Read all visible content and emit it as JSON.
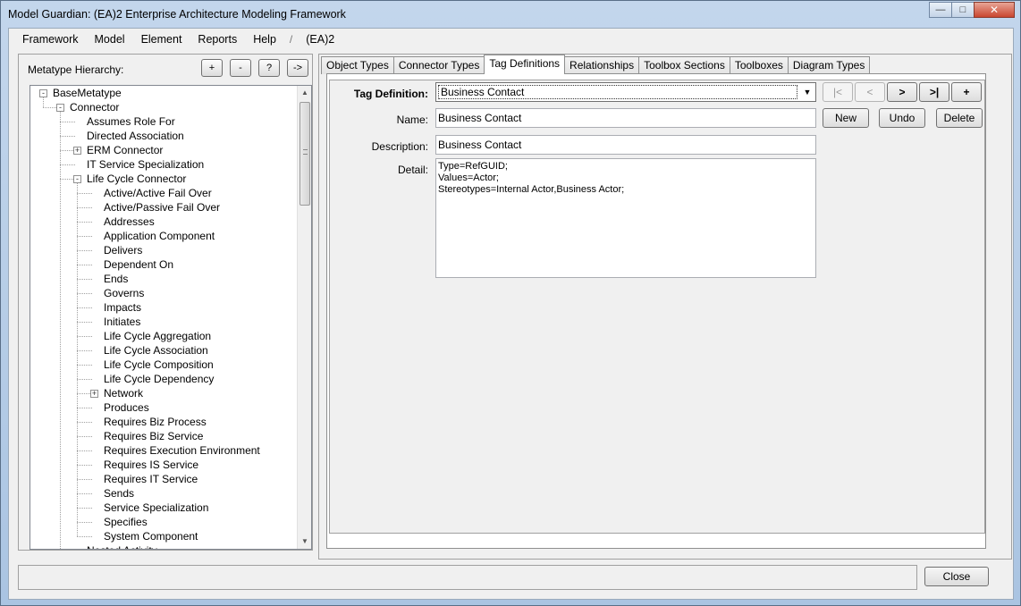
{
  "window": {
    "title": "Model Guardian: (EA)2 Enterprise Architecture Modeling Framework",
    "minimize_glyph": "—",
    "maximize_glyph": "□",
    "close_glyph": "✕"
  },
  "menu": {
    "items": [
      "Framework",
      "Model",
      "Element",
      "Reports",
      "Help"
    ],
    "separator": "/",
    "context": "(EA)2"
  },
  "left_panel": {
    "label": "Metatype Hierarchy:",
    "buttons": [
      "+",
      "-",
      "?",
      "->"
    ],
    "tree": [
      {
        "label": "BaseMetatype",
        "level": 0,
        "expander": "-"
      },
      {
        "label": "Connector",
        "level": 1,
        "expander": "-"
      },
      {
        "label": "Assumes Role For",
        "level": 2,
        "expander": null
      },
      {
        "label": "Directed Association",
        "level": 2,
        "expander": null
      },
      {
        "label": "ERM Connector",
        "level": 2,
        "expander": "+"
      },
      {
        "label": "IT Service Specialization",
        "level": 2,
        "expander": null
      },
      {
        "label": "Life Cycle Connector",
        "level": 2,
        "expander": "-"
      },
      {
        "label": "Active/Active Fail Over",
        "level": 3,
        "expander": null
      },
      {
        "label": "Active/Passive Fail Over",
        "level": 3,
        "expander": null
      },
      {
        "label": "Addresses",
        "level": 3,
        "expander": null
      },
      {
        "label": "Application Component",
        "level": 3,
        "expander": null
      },
      {
        "label": "Delivers",
        "level": 3,
        "expander": null
      },
      {
        "label": "Dependent On",
        "level": 3,
        "expander": null
      },
      {
        "label": "Ends",
        "level": 3,
        "expander": null
      },
      {
        "label": "Governs",
        "level": 3,
        "expander": null
      },
      {
        "label": "Impacts",
        "level": 3,
        "expander": null
      },
      {
        "label": "Initiates",
        "level": 3,
        "expander": null
      },
      {
        "label": "Life Cycle Aggregation",
        "level": 3,
        "expander": null
      },
      {
        "label": "Life Cycle Association",
        "level": 3,
        "expander": null
      },
      {
        "label": "Life Cycle Composition",
        "level": 3,
        "expander": null
      },
      {
        "label": "Life Cycle Dependency",
        "level": 3,
        "expander": null
      },
      {
        "label": "Network",
        "level": 3,
        "expander": "+"
      },
      {
        "label": "Produces",
        "level": 3,
        "expander": null
      },
      {
        "label": "Requires Biz Process",
        "level": 3,
        "expander": null
      },
      {
        "label": "Requires Biz Service",
        "level": 3,
        "expander": null
      },
      {
        "label": "Requires Execution Environment",
        "level": 3,
        "expander": null
      },
      {
        "label": "Requires IS Service",
        "level": 3,
        "expander": null
      },
      {
        "label": "Requires IT Service",
        "level": 3,
        "expander": null
      },
      {
        "label": "Sends",
        "level": 3,
        "expander": null
      },
      {
        "label": "Service Specialization",
        "level": 3,
        "expander": null
      },
      {
        "label": "Specifies",
        "level": 3,
        "expander": null
      },
      {
        "label": "System Component",
        "level": 3,
        "expander": null
      },
      {
        "label": "Nested Activity",
        "level": 2,
        "expander": null
      }
    ]
  },
  "tabs": [
    "Object Types",
    "Connector Types",
    "Tag Definitions",
    "Relationships",
    "Toolbox Sections",
    "Toolboxes",
    "Diagram Types"
  ],
  "active_tab": "Tag Definitions",
  "form": {
    "tag_definition_label": "Tag Definition:",
    "tag_definition_value": "Business Contact",
    "nav_buttons": [
      "|<",
      "<",
      ">",
      ">|",
      "+"
    ],
    "name_label": "Name:",
    "name_value": "Business Contact",
    "description_label": "Description:",
    "description_value": "Business Contact",
    "detail_label": "Detail:",
    "detail_value": "Type=RefGUID;\nValues=Actor;\nStereotypes=Internal Actor,Business Actor;",
    "new_button": "New",
    "undo_button": "Undo",
    "delete_button": "Delete"
  },
  "footer": {
    "status_text": "",
    "close_button": "Close"
  }
}
